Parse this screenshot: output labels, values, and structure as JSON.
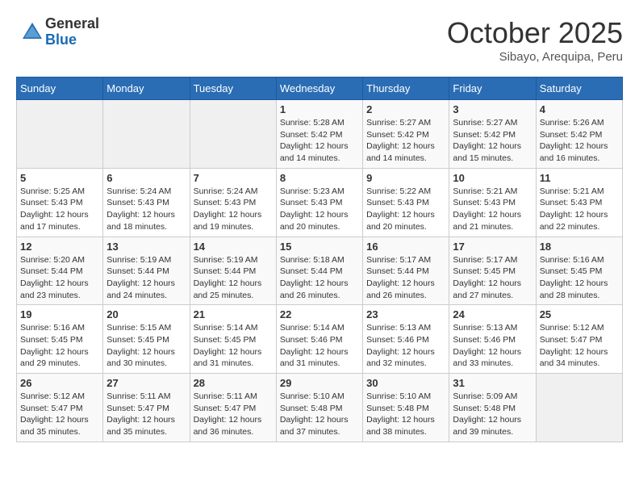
{
  "logo": {
    "general": "General",
    "blue": "Blue"
  },
  "header": {
    "month": "October 2025",
    "location": "Sibayo, Arequipa, Peru"
  },
  "weekdays": [
    "Sunday",
    "Monday",
    "Tuesday",
    "Wednesday",
    "Thursday",
    "Friday",
    "Saturday"
  ],
  "weeks": [
    [
      {
        "day": "",
        "info": ""
      },
      {
        "day": "",
        "info": ""
      },
      {
        "day": "",
        "info": ""
      },
      {
        "day": "1",
        "info": "Sunrise: 5:28 AM\nSunset: 5:42 PM\nDaylight: 12 hours\nand 14 minutes."
      },
      {
        "day": "2",
        "info": "Sunrise: 5:27 AM\nSunset: 5:42 PM\nDaylight: 12 hours\nand 14 minutes."
      },
      {
        "day": "3",
        "info": "Sunrise: 5:27 AM\nSunset: 5:42 PM\nDaylight: 12 hours\nand 15 minutes."
      },
      {
        "day": "4",
        "info": "Sunrise: 5:26 AM\nSunset: 5:42 PM\nDaylight: 12 hours\nand 16 minutes."
      }
    ],
    [
      {
        "day": "5",
        "info": "Sunrise: 5:25 AM\nSunset: 5:43 PM\nDaylight: 12 hours\nand 17 minutes."
      },
      {
        "day": "6",
        "info": "Sunrise: 5:24 AM\nSunset: 5:43 PM\nDaylight: 12 hours\nand 18 minutes."
      },
      {
        "day": "7",
        "info": "Sunrise: 5:24 AM\nSunset: 5:43 PM\nDaylight: 12 hours\nand 19 minutes."
      },
      {
        "day": "8",
        "info": "Sunrise: 5:23 AM\nSunset: 5:43 PM\nDaylight: 12 hours\nand 20 minutes."
      },
      {
        "day": "9",
        "info": "Sunrise: 5:22 AM\nSunset: 5:43 PM\nDaylight: 12 hours\nand 20 minutes."
      },
      {
        "day": "10",
        "info": "Sunrise: 5:21 AM\nSunset: 5:43 PM\nDaylight: 12 hours\nand 21 minutes."
      },
      {
        "day": "11",
        "info": "Sunrise: 5:21 AM\nSunset: 5:43 PM\nDaylight: 12 hours\nand 22 minutes."
      }
    ],
    [
      {
        "day": "12",
        "info": "Sunrise: 5:20 AM\nSunset: 5:44 PM\nDaylight: 12 hours\nand 23 minutes."
      },
      {
        "day": "13",
        "info": "Sunrise: 5:19 AM\nSunset: 5:44 PM\nDaylight: 12 hours\nand 24 minutes."
      },
      {
        "day": "14",
        "info": "Sunrise: 5:19 AM\nSunset: 5:44 PM\nDaylight: 12 hours\nand 25 minutes."
      },
      {
        "day": "15",
        "info": "Sunrise: 5:18 AM\nSunset: 5:44 PM\nDaylight: 12 hours\nand 26 minutes."
      },
      {
        "day": "16",
        "info": "Sunrise: 5:17 AM\nSunset: 5:44 PM\nDaylight: 12 hours\nand 26 minutes."
      },
      {
        "day": "17",
        "info": "Sunrise: 5:17 AM\nSunset: 5:45 PM\nDaylight: 12 hours\nand 27 minutes."
      },
      {
        "day": "18",
        "info": "Sunrise: 5:16 AM\nSunset: 5:45 PM\nDaylight: 12 hours\nand 28 minutes."
      }
    ],
    [
      {
        "day": "19",
        "info": "Sunrise: 5:16 AM\nSunset: 5:45 PM\nDaylight: 12 hours\nand 29 minutes."
      },
      {
        "day": "20",
        "info": "Sunrise: 5:15 AM\nSunset: 5:45 PM\nDaylight: 12 hours\nand 30 minutes."
      },
      {
        "day": "21",
        "info": "Sunrise: 5:14 AM\nSunset: 5:45 PM\nDaylight: 12 hours\nand 31 minutes."
      },
      {
        "day": "22",
        "info": "Sunrise: 5:14 AM\nSunset: 5:46 PM\nDaylight: 12 hours\nand 31 minutes."
      },
      {
        "day": "23",
        "info": "Sunrise: 5:13 AM\nSunset: 5:46 PM\nDaylight: 12 hours\nand 32 minutes."
      },
      {
        "day": "24",
        "info": "Sunrise: 5:13 AM\nSunset: 5:46 PM\nDaylight: 12 hours\nand 33 minutes."
      },
      {
        "day": "25",
        "info": "Sunrise: 5:12 AM\nSunset: 5:47 PM\nDaylight: 12 hours\nand 34 minutes."
      }
    ],
    [
      {
        "day": "26",
        "info": "Sunrise: 5:12 AM\nSunset: 5:47 PM\nDaylight: 12 hours\nand 35 minutes."
      },
      {
        "day": "27",
        "info": "Sunrise: 5:11 AM\nSunset: 5:47 PM\nDaylight: 12 hours\nand 35 minutes."
      },
      {
        "day": "28",
        "info": "Sunrise: 5:11 AM\nSunset: 5:47 PM\nDaylight: 12 hours\nand 36 minutes."
      },
      {
        "day": "29",
        "info": "Sunrise: 5:10 AM\nSunset: 5:48 PM\nDaylight: 12 hours\nand 37 minutes."
      },
      {
        "day": "30",
        "info": "Sunrise: 5:10 AM\nSunset: 5:48 PM\nDaylight: 12 hours\nand 38 minutes."
      },
      {
        "day": "31",
        "info": "Sunrise: 5:09 AM\nSunset: 5:48 PM\nDaylight: 12 hours\nand 39 minutes."
      },
      {
        "day": "",
        "info": ""
      }
    ]
  ]
}
